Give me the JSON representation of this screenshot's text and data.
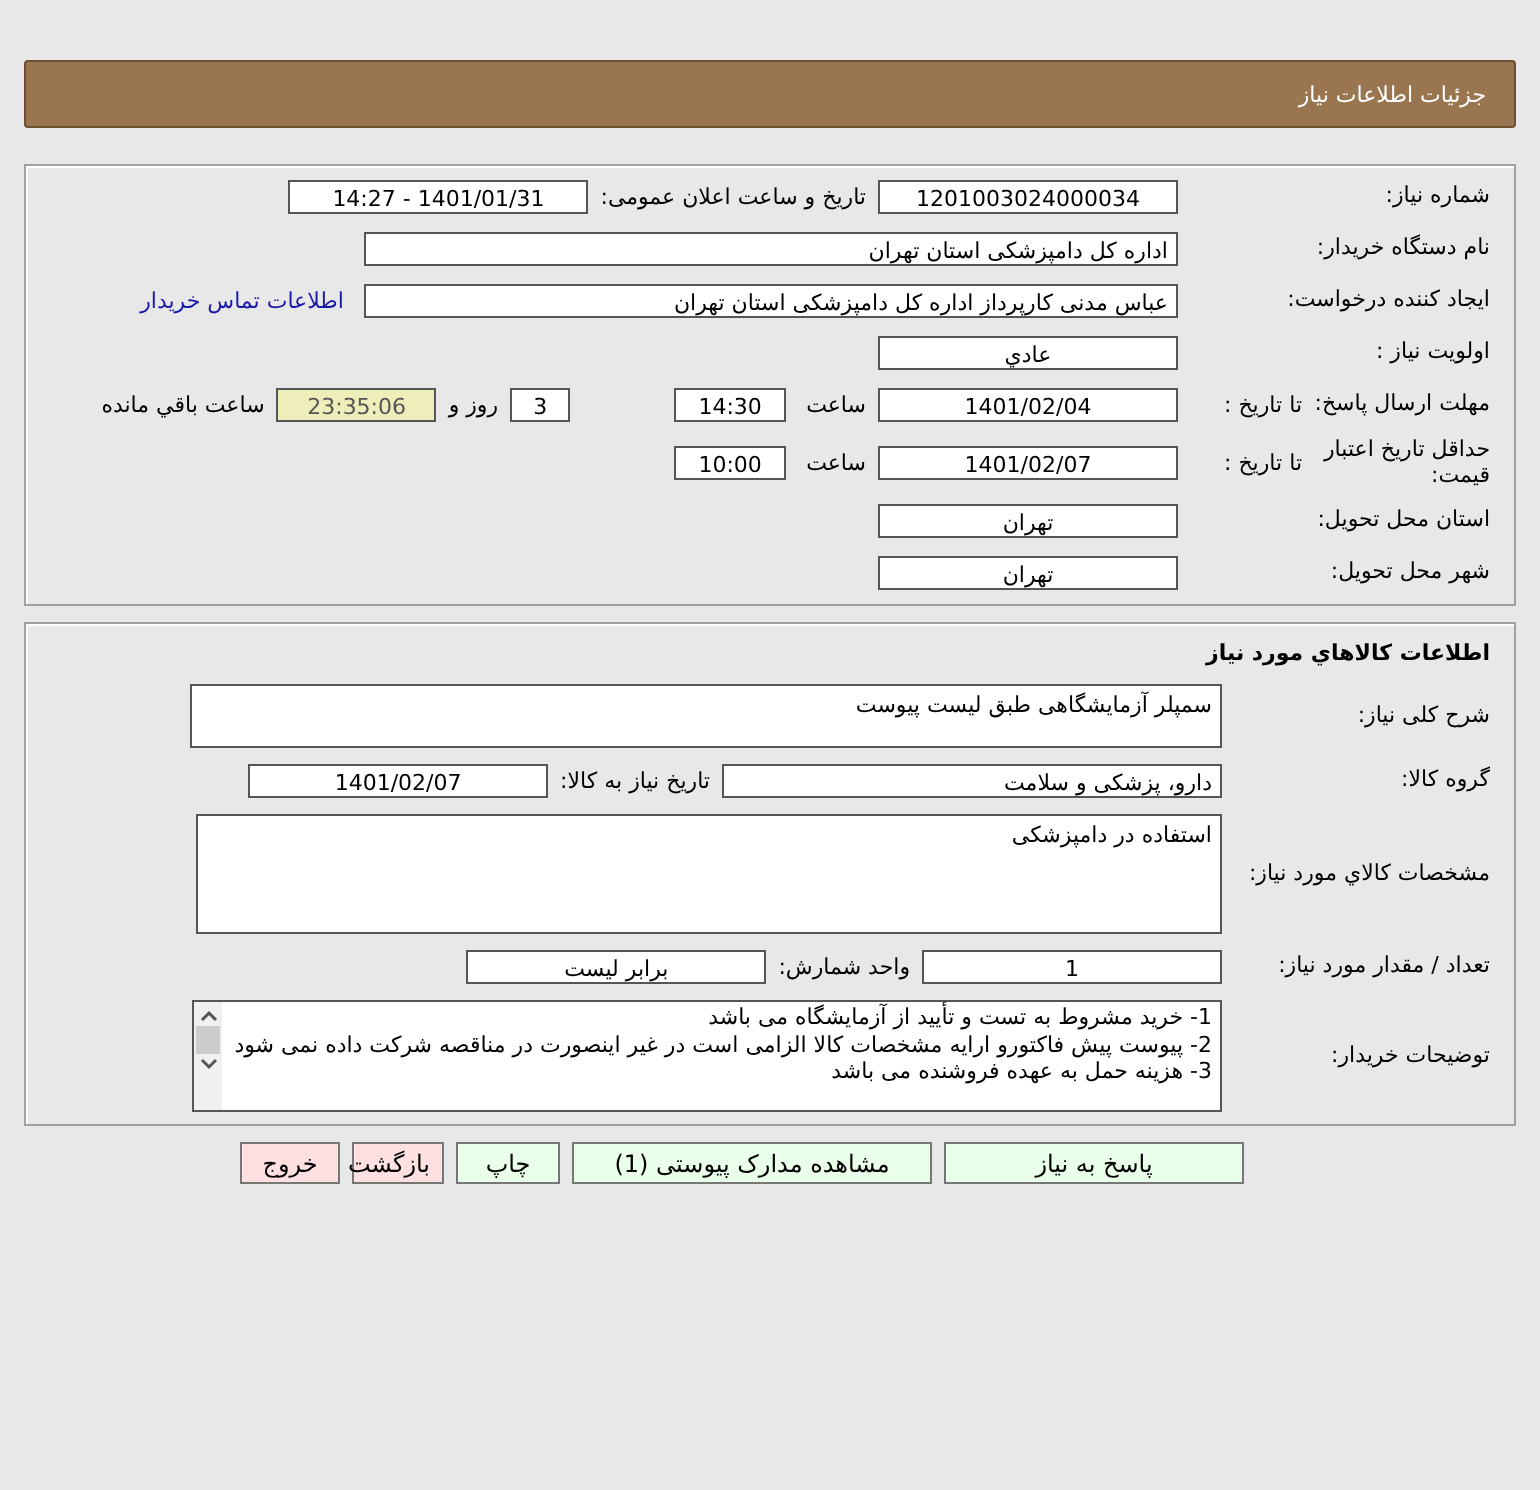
{
  "header": {
    "title": "جزئیات اطلاعات نیاز"
  },
  "need_info": {
    "rows": [
      {
        "label": "شماره نیاز:",
        "items": [
          {
            "kind": "field",
            "value": "1201003024000034"
          },
          {
            "kind": "text",
            "value": "تاریخ و ساعت اعلان عمومی:"
          },
          {
            "kind": "field",
            "value": "1401/01/31 - 14:27"
          }
        ]
      },
      {
        "label": "نام دستگاه خریدار:",
        "items": [
          {
            "kind": "long_field",
            "value": "اداره کل دامپزشکی استان تهران"
          }
        ]
      },
      {
        "label": "ایجاد کننده درخواست:",
        "items": [
          {
            "kind": "long_field",
            "value": "عباس  مدنی کارپرداز اداره کل دامپزشکی استان تهران"
          },
          {
            "kind": "link",
            "value": "اطلاعات تماس خریدار"
          }
        ]
      },
      {
        "label": "اولویت نیاز :",
        "items": [
          {
            "kind": "field",
            "value": "عادي"
          }
        ]
      },
      {
        "label": "مهلت ارسال پاسخ:",
        "sublabel": "تا تاریخ :",
        "items": [
          {
            "kind": "field",
            "value": "1401/02/04"
          },
          {
            "kind": "text",
            "value": "ساعت"
          },
          {
            "kind": "short_field",
            "value": "14:30"
          },
          {
            "kind": "tiny_field",
            "value": "3"
          },
          {
            "kind": "text",
            "value": "روز و"
          },
          {
            "kind": "timer",
            "value": "23:35:06"
          },
          {
            "kind": "text",
            "value": "ساعت باقي مانده"
          }
        ]
      },
      {
        "label": "حداقل تاریخ اعتبار قیمت:",
        "sublabel": "تا تاریخ :",
        "items": [
          {
            "kind": "field",
            "value": "1401/02/07"
          },
          {
            "kind": "text",
            "value": "ساعت"
          },
          {
            "kind": "short_field",
            "value": "10:00"
          }
        ]
      },
      {
        "label": "استان محل تحویل:",
        "items": [
          {
            "kind": "field",
            "value": "تهران"
          }
        ]
      },
      {
        "label": "شهر محل تحویل:",
        "items": [
          {
            "kind": "field",
            "value": "تهران"
          }
        ]
      }
    ]
  },
  "goods_info": {
    "title": "اطلاعات کالاهاي مورد نیاز",
    "rows": [
      {
        "label": "شرح کلی نیاز:",
        "items": [
          {
            "kind": "box",
            "value": "سمپلر آزمایشگاهی طبق لیست پیوست"
          }
        ]
      },
      {
        "label": "گروه کالا:",
        "items": [
          {
            "kind": "mid_field",
            "value": "دارو، پزشکی و سلامت"
          },
          {
            "kind": "text",
            "value": "تاریخ نیاز به کالا:"
          },
          {
            "kind": "field",
            "value": "1401/02/07"
          }
        ]
      },
      {
        "label": "مشخصات کالاي مورد نیاز:",
        "items": [
          {
            "kind": "tall_box",
            "value": "استفاده در دامپزشکی"
          }
        ]
      },
      {
        "label": "تعداد / مقدار مورد نیاز:",
        "items": [
          {
            "kind": "field",
            "value": "1"
          },
          {
            "kind": "text",
            "value": "واحد شمارش:"
          },
          {
            "kind": "field",
            "value": "برابر لیست"
          }
        ]
      },
      {
        "label": "توضیحات خریدار:",
        "items": [
          {
            "kind": "notes",
            "lines": [
              "1- خرید مشروط به تست و تأیید از آزمایشگاه می باشد",
              "2- پیوست پیش فاکتورو ارایه مشخصات کالا الزامی است در غیر اینصورت در مناقصه شرکت داده نمی شود",
              "3- هزینه حمل به عهده فروشنده می باشد"
            ]
          }
        ]
      }
    ]
  },
  "actions": [
    {
      "label": "پاسخ به نیاز",
      "kind": "primary"
    },
    {
      "label": "مشاهده مدارک پیوستی (1)",
      "kind": "primary"
    },
    {
      "label": "چاپ",
      "kind": "primary"
    },
    {
      "label": "بازگشت",
      "kind": "danger"
    },
    {
      "label": "خروج",
      "kind": "danger"
    }
  ]
}
